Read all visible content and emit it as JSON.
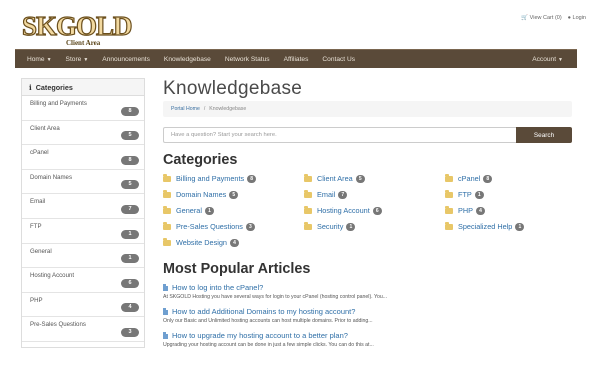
{
  "brand": {
    "logo_text": "SKGOLD",
    "logo_subtitle": "Client Area"
  },
  "toplinks": {
    "cart": "View Cart (0)",
    "login": "Login"
  },
  "nav": {
    "items": [
      "Home",
      "Store",
      "Announcements",
      "Knowledgebase",
      "Network Status",
      "Affiliates",
      "Contact Us"
    ],
    "account": "Account"
  },
  "sidebar": {
    "title": "Categories",
    "items": [
      {
        "label": "Billing and Payments",
        "count": "8"
      },
      {
        "label": "Client Area",
        "count": "5"
      },
      {
        "label": "cPanel",
        "count": "8"
      },
      {
        "label": "Domain Names",
        "count": "5"
      },
      {
        "label": "Email",
        "count": "7"
      },
      {
        "label": "FTP",
        "count": "1"
      },
      {
        "label": "General",
        "count": "1"
      },
      {
        "label": "Hosting Account",
        "count": "6"
      },
      {
        "label": "PHP",
        "count": "4"
      },
      {
        "label": "Pre-Sales Questions",
        "count": "3"
      }
    ]
  },
  "main": {
    "title": "Knowledgebase",
    "breadcrumb": {
      "home": "Portal Home",
      "sep": "/",
      "current": "Knowledgebase"
    },
    "search": {
      "placeholder": "Have a question? Start your search here.",
      "button": "Search"
    },
    "categories_heading": "Categories",
    "categories": [
      {
        "label": "Billing and Payments",
        "count": "8"
      },
      {
        "label": "Client Area",
        "count": "5"
      },
      {
        "label": "cPanel",
        "count": "8"
      },
      {
        "label": "Domain Names",
        "count": "5"
      },
      {
        "label": "Email",
        "count": "7"
      },
      {
        "label": "FTP",
        "count": "1"
      },
      {
        "label": "General",
        "count": "1"
      },
      {
        "label": "Hosting Account",
        "count": "6"
      },
      {
        "label": "PHP",
        "count": "4"
      },
      {
        "label": "Pre-Sales Questions",
        "count": "3"
      },
      {
        "label": "Security",
        "count": "1"
      },
      {
        "label": "Specialized Help",
        "count": "1"
      },
      {
        "label": "Website Design",
        "count": "4"
      }
    ],
    "popular_heading": "Most Popular Articles",
    "articles": [
      {
        "title": "How to log into the cPanel?",
        "snippet": "At SKGOLD Hosting you have several ways for login to your cPanel (hosting control panel). You..."
      },
      {
        "title": "How to add Additional Domains to my hosting account?",
        "snippet": "Only our Basic and Unlimited hosting accounts can host multiple domains. Prior to adding..."
      },
      {
        "title": "How to upgrade my hosting account to a better plan?",
        "snippet": "Upgrading your hosting account can be done in just a few simple clicks. You can do this at..."
      }
    ]
  },
  "colors": {
    "nav_bg": "#5a4a39",
    "link": "#2f6fa7",
    "badge": "#777777",
    "folder": "#e8c768"
  }
}
